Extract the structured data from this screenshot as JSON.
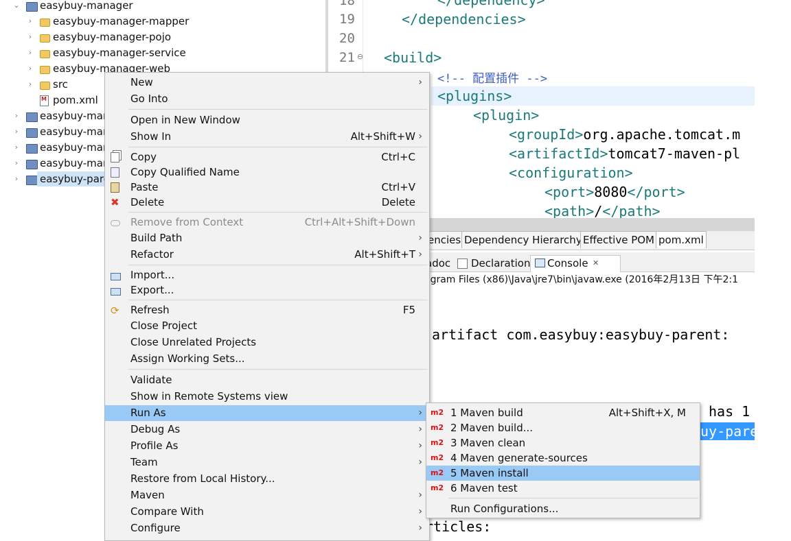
{
  "tree": {
    "items": [
      {
        "label": "easybuy-manager",
        "arrow": "⌄",
        "icon": "project-icon"
      },
      {
        "label": "easybuy-manager-mapper",
        "arrow": "›",
        "icon": "folder-icon"
      },
      {
        "label": "easybuy-manager-pojo",
        "arrow": "›",
        "icon": "folder-icon"
      },
      {
        "label": "easybuy-manager-service",
        "arrow": "›",
        "icon": "folder-icon"
      },
      {
        "label": "easybuy-manager-web",
        "arrow": "›",
        "icon": "folder-icon"
      },
      {
        "label": "src",
        "arrow": "›",
        "icon": "folder-icon"
      },
      {
        "label": "pom.xml",
        "arrow": "",
        "icon": "pom-file-icon"
      },
      {
        "label": "easybuy-man",
        "arrow": "›",
        "icon": "project-icon"
      },
      {
        "label": "easybuy-man",
        "arrow": "›",
        "icon": "project-icon"
      },
      {
        "label": "easybuy-man",
        "arrow": "›",
        "icon": "project-icon"
      },
      {
        "label": "easybuy-man",
        "arrow": "›",
        "icon": "project-icon"
      },
      {
        "label": "easybuy-pare",
        "arrow": "›",
        "icon": "project-icon",
        "selected": true
      }
    ]
  },
  "editor": {
    "line_numbers": [
      "18",
      "19",
      "20",
      "21"
    ],
    "fold_marker": "⊖",
    "lines": {
      "l1": "</dependency>",
      "l2": "</dependencies>",
      "l3": "<build>",
      "l4": "<!-- 配置插件 -->",
      "l5": "<plugins>",
      "l6": "<plugin>",
      "l7a": "<groupId>",
      "l7b": "org.apache.tomcat.m",
      "l8a": "<artifactId>",
      "l8b": "tomcat7-maven-pl",
      "l9": "<configuration>",
      "l10a": "<port>",
      "l10b": "8080",
      "l10c": "</port>",
      "l11a": "<path>",
      "l11b": "/",
      "l11c": "</path>"
    }
  },
  "pom_tabs": [
    "encies",
    "Dependency Hierarchy",
    "Effective POM",
    "pom.xml"
  ],
  "console": {
    "tabs": {
      "javadoc": "adoc",
      "declaration": "Declaration",
      "console": "Console",
      "close": "✕"
    },
    "path": "ogram Files (x86)\\Java\\jre7\\bin\\javaw.exe (2016年2月13日 下午2:1",
    "lines": {
      "artifact": "artifact com.easybuy:easybuy-parent:",
      "has": "has 1",
      "selected": "uy-pare",
      "articles": "rticles:"
    }
  },
  "context_menu": {
    "items": [
      {
        "label": "New",
        "submenu": true
      },
      {
        "label": "Go Into"
      },
      {
        "label": "Open in New Window"
      },
      {
        "label": "Show In",
        "accel": "Alt+Shift+W",
        "submenu": true
      },
      {
        "label": "Copy",
        "accel": "Ctrl+C",
        "icon": "copy-icon"
      },
      {
        "label": "Copy Qualified Name",
        "icon": "copy-qualified-icon"
      },
      {
        "label": "Paste",
        "accel": "Ctrl+V",
        "icon": "paste-icon"
      },
      {
        "label": "Delete",
        "accel": "Delete",
        "icon": "delete-icon"
      },
      {
        "label": "Remove from Context",
        "accel": "Ctrl+Alt+Shift+Down",
        "disabled": true,
        "icon": "remove-context-icon"
      },
      {
        "label": "Build Path",
        "submenu": true
      },
      {
        "label": "Refactor",
        "accel": "Alt+Shift+T",
        "submenu": true
      },
      {
        "label": "Import...",
        "icon": "import-icon"
      },
      {
        "label": "Export...",
        "icon": "export-icon"
      },
      {
        "label": "Refresh",
        "accel": "F5",
        "icon": "refresh-icon"
      },
      {
        "label": "Close Project"
      },
      {
        "label": "Close Unrelated Projects"
      },
      {
        "label": "Assign Working Sets..."
      },
      {
        "label": "Validate"
      },
      {
        "label": "Show in Remote Systems view"
      },
      {
        "label": "Run As",
        "submenu": true,
        "active": true
      },
      {
        "label": "Debug As",
        "submenu": true
      },
      {
        "label": "Profile As",
        "submenu": true
      },
      {
        "label": "Team",
        "submenu": true
      },
      {
        "label": "Restore from Local History..."
      },
      {
        "label": "Maven",
        "submenu": true
      },
      {
        "label": "Compare With",
        "submenu": true
      },
      {
        "label": "Configure",
        "submenu": true
      }
    ],
    "submenu_arrow": "›"
  },
  "run_as_submenu": {
    "badge": "m2",
    "items": [
      {
        "label": "1 Maven build",
        "accel": "Alt+Shift+X, M"
      },
      {
        "label": "2 Maven build..."
      },
      {
        "label": "3 Maven clean"
      },
      {
        "label": "4 Maven generate-sources"
      },
      {
        "label": "5 Maven install",
        "active": true
      },
      {
        "label": "6 Maven test"
      },
      {
        "label": "Run Configurations..."
      }
    ]
  },
  "colors": {
    "menu_highlight": "#99c9f5",
    "selection_blue": "#3399ff",
    "xml_tag": "#1a7a7a",
    "m2_badge": "#dd1111"
  }
}
